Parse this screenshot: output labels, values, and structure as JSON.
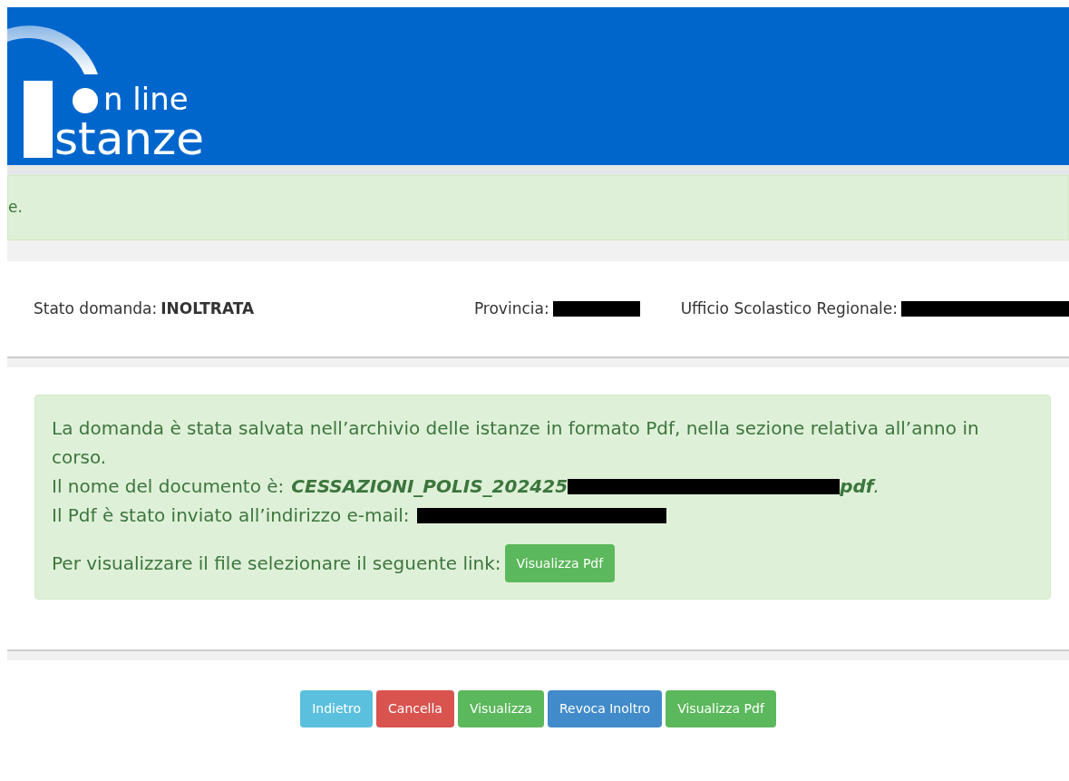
{
  "header": {
    "logo_line_1": "n line",
    "logo_line_2": "stanze"
  },
  "top_alert": {
    "text": "e."
  },
  "status": {
    "fields": [
      {
        "label": "Stato domanda:",
        "value": "INOLTRATA"
      },
      {
        "label": "Provincia:",
        "redacted": true
      },
      {
        "label": "Ufficio Scolastico Regionale:",
        "redacted": true
      }
    ]
  },
  "result_alert": {
    "message": "La domanda è stata salvata nell’archivio delle istanze in formato Pdf, nella sezione relativa all’anno in corso.",
    "document": {
      "label": "Il nome del documento è:",
      "value_start": "CESSAZIONI_POLIS_202425",
      "redacted": true,
      "value_end": "**pdf**."
    },
    "email": {
      "label": "Il Pdf è stato inviato all’indirizzo e-mail:",
      "redacted": true
    },
    "link_text": "Per visualizzare il file selezionare il seguente link:",
    "link_button": "Visualizza Pdf"
  },
  "buttons": [
    {
      "label": "Indietro",
      "kind": "info"
    },
    {
      "label": "Cancella",
      "kind": "danger"
    },
    {
      "label": "Visualizza",
      "kind": "success"
    },
    {
      "label": "Revoca Inoltro",
      "kind": "primary"
    },
    {
      "label": "Visualizza Pdf",
      "kind": "success"
    }
  ]
}
